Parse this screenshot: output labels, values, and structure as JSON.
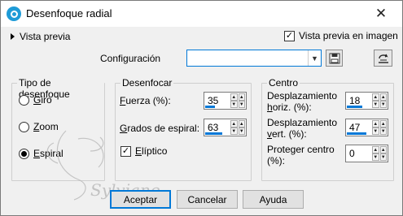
{
  "window": {
    "title": "Desenfoque radial",
    "close_glyph": "✕"
  },
  "preview": {
    "toggle_label": "Vista previa",
    "checkbox_label": "Vista previa en imagen",
    "checked": true
  },
  "config": {
    "label": "Configuración",
    "value": ""
  },
  "tipo": {
    "title": "Tipo de desenfoque",
    "options": [
      {
        "first": "G",
        "rest": "iro",
        "selected": false
      },
      {
        "first": "Z",
        "rest": "oom",
        "selected": false
      },
      {
        "first": "E",
        "rest": "spiral",
        "selected": true
      }
    ]
  },
  "desenfocar": {
    "title": "Desenfocar",
    "fuerza_label_first": "F",
    "fuerza_label_rest": "uerza (%):",
    "fuerza_value": "35",
    "fuerza_fraction": 0.35,
    "grados_label_first": "G",
    "grados_label_rest": "rados de espiral:",
    "grados_value": "63",
    "grados_fraction": 0.63,
    "eliptico_first": "E",
    "eliptico_rest": "líptico",
    "eliptico_checked": true
  },
  "centro": {
    "title": "Centro",
    "horiz_label_line1": "Desplazamiento",
    "horiz_label_line2_first": "h",
    "horiz_label_line2_rest": "oriz. (%):",
    "horiz_value": "18",
    "horiz_fraction": 0.59,
    "vert_label_line1": "Desplazamiento",
    "vert_label_line2_first": "v",
    "vert_label_line2_rest": "ert. (%):",
    "vert_value": "47",
    "vert_fraction": 0.74,
    "proteger_label_line1": "Proteger centro",
    "proteger_label_line2": "(%):",
    "proteger_value": "0",
    "proteger_fraction": 0
  },
  "buttons": {
    "accept": "Aceptar",
    "cancel": "Cancelar",
    "help": "Ayuda"
  },
  "watermark_text": "Sylviane",
  "colors": {
    "accent": "#0078d7",
    "app_icon": "#1e9bd7"
  }
}
